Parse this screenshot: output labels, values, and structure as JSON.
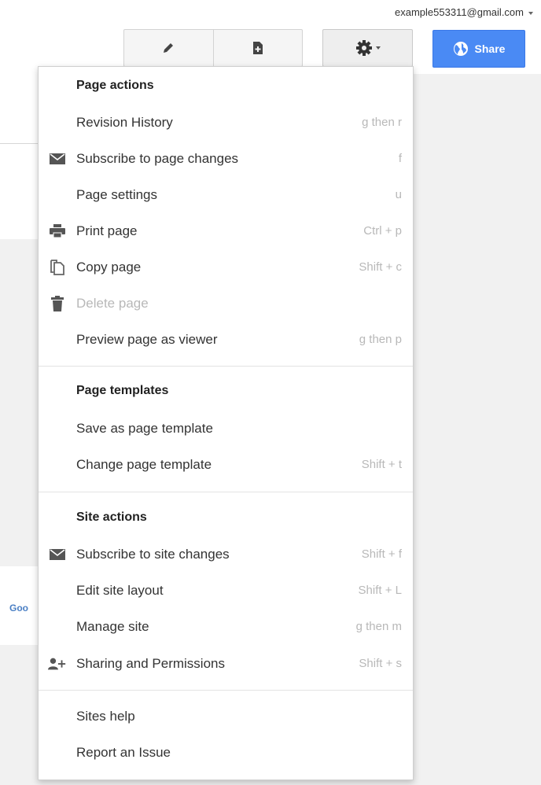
{
  "header": {
    "account_email": "example553311@gmail.com",
    "edit_icon": "pencil-icon",
    "new_page_icon": "new-page-icon",
    "settings_icon": "gear-icon",
    "share_label": "Share"
  },
  "background": {
    "google_fragment": "Goo"
  },
  "menu": {
    "page_actions": {
      "title": "Page actions",
      "items": [
        {
          "label": "Revision History",
          "shortcut": "g then r",
          "icon": ""
        },
        {
          "label": "Subscribe to page changes",
          "shortcut": "f",
          "icon": "envelope-icon"
        },
        {
          "label": "Page settings",
          "shortcut": "u",
          "icon": ""
        },
        {
          "label": "Print page",
          "shortcut": "Ctrl + p",
          "icon": "printer-icon"
        },
        {
          "label": "Copy page",
          "shortcut": "Shift + c",
          "icon": "copy-icon"
        },
        {
          "label": "Delete page",
          "shortcut": "",
          "icon": "trash-icon",
          "disabled": true
        },
        {
          "label": "Preview page as viewer",
          "shortcut": "g then p",
          "icon": ""
        }
      ]
    },
    "page_templates": {
      "title": "Page templates",
      "items": [
        {
          "label": "Save as page template",
          "shortcut": ""
        },
        {
          "label": "Change page template",
          "shortcut": "Shift + t"
        }
      ]
    },
    "site_actions": {
      "title": "Site actions",
      "items": [
        {
          "label": "Subscribe to site changes",
          "shortcut": "Shift + f",
          "icon": "envelope-icon"
        },
        {
          "label": "Edit site layout",
          "shortcut": "Shift + L",
          "icon": ""
        },
        {
          "label": "Manage site",
          "shortcut": "g then m",
          "icon": ""
        },
        {
          "label": "Sharing and Permissions",
          "shortcut": "Shift + s",
          "icon": "add-person-icon"
        }
      ]
    },
    "help": {
      "items": [
        {
          "label": "Sites help"
        },
        {
          "label": "Report an Issue"
        }
      ]
    }
  }
}
